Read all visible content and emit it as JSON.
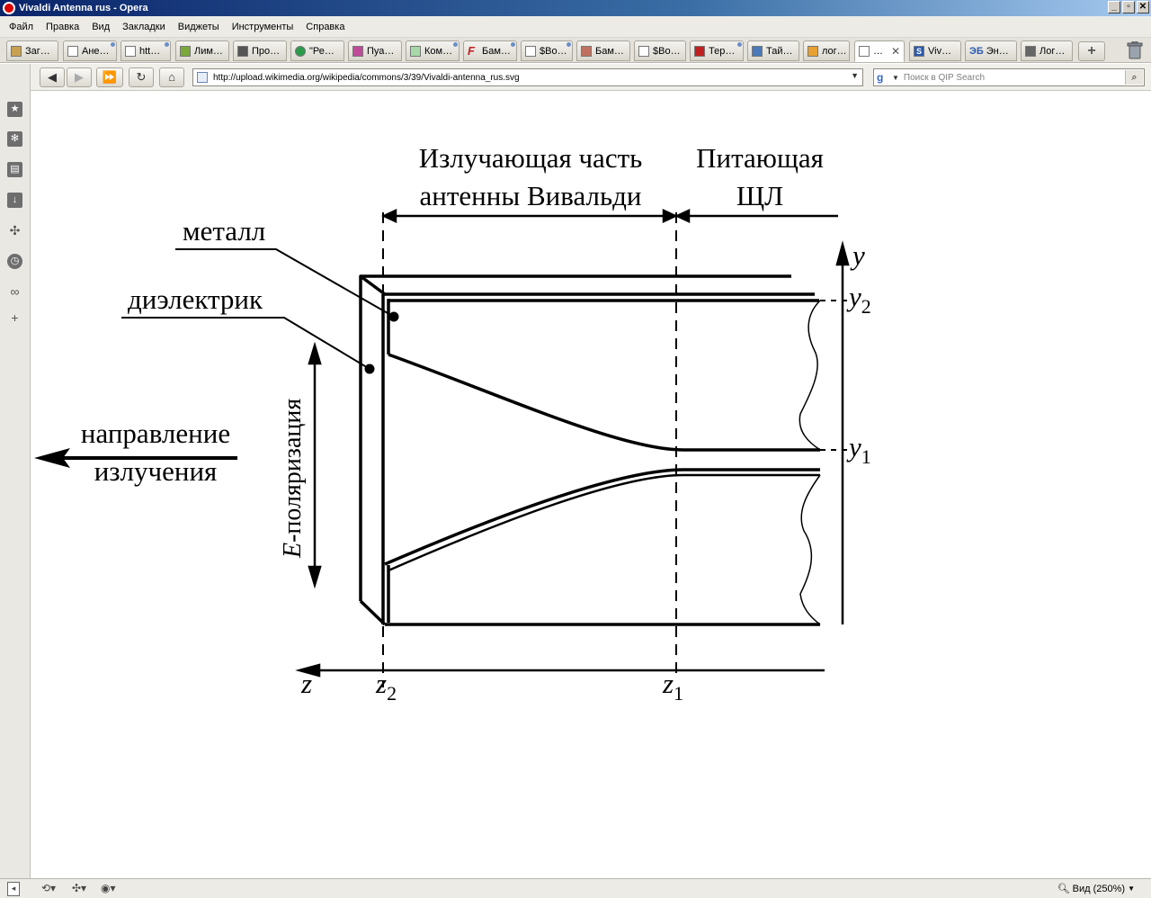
{
  "window": {
    "title": "Vivaldi Antenna rus - Opera",
    "buttons": {
      "minimize": "_",
      "maximize": "▫",
      "close": "✕"
    }
  },
  "menu": [
    "Файл",
    "Правка",
    "Вид",
    "Закладки",
    "Виджеты",
    "Инструменты",
    "Справка"
  ],
  "tabs": [
    {
      "label": "Заг…",
      "icon": "download-icon"
    },
    {
      "label": "Ане…",
      "icon": "page-icon"
    },
    {
      "label": "htt…",
      "icon": "page-icon"
    },
    {
      "label": "Лим…",
      "icon": "plant-icon"
    },
    {
      "label": "Про…",
      "icon": "satellite-icon"
    },
    {
      "label": "\"Ре…",
      "icon": "circle-icon"
    },
    {
      "label": "Пуа…",
      "icon": "flower-icon"
    },
    {
      "label": "Ком…",
      "icon": "leaf-icon"
    },
    {
      "label": "Бам…",
      "icon": "f-icon"
    },
    {
      "label": "$Bo…",
      "icon": "page-icon"
    },
    {
      "label": "Бам…",
      "icon": "photo-icon"
    },
    {
      "label": "$Bo…",
      "icon": "page-icon"
    },
    {
      "label": "Тер…",
      "icon": "pet-icon"
    },
    {
      "label": "Тай…",
      "icon": "grid-icon"
    },
    {
      "label": "лог…",
      "icon": "google-icon"
    },
    {
      "label": "…",
      "icon": "page-icon",
      "active": true,
      "close": "✕"
    },
    {
      "label": "Viv…",
      "icon": "s-icon"
    },
    {
      "label": "Эн…",
      "icon": "eb-icon",
      "prefix": "ЭБ"
    },
    {
      "label": "Лог…",
      "icon": "chip-icon"
    }
  ],
  "new_tab_label": "+",
  "nav": {
    "back": "◀",
    "forward": "▶",
    "fast_forward": "⏩",
    "reload": "↻",
    "home": "⌂",
    "url": "http://upload.wikimedia.org/wikipedia/commons/3/39/Vivaldi-antenna_rus.svg",
    "url_dropdown": "▼",
    "search_engine": "g",
    "search_dropdown": "▼",
    "search_placeholder": "Поиск в QIP Search",
    "search_button": "⌕"
  },
  "sidebar": [
    "bookmarks-icon",
    "widgets-icon",
    "notes-icon",
    "downloads-icon",
    "transfers-icon",
    "history-icon",
    "links-icon",
    "add-panel-icon"
  ],
  "diagram": {
    "heading_radiating_line1": "Излучающая часть",
    "heading_radiating_line2": "антенны Вивальди",
    "heading_feed_line1": "Питающая",
    "heading_feed_line2": "ЩЛ",
    "label_metal": "металл",
    "label_dielectric": "диэлектрик",
    "label_direction_line1": "направление",
    "label_direction_line2": "излучения",
    "label_polarization_italic": "E",
    "label_polarization_rest": "-поляризация",
    "axis_y": "y",
    "axis_y2_base": "y",
    "axis_y2_sub": "2",
    "axis_y1_base": "y",
    "axis_y1_sub": "1",
    "axis_z": "z",
    "axis_z2_base": "z",
    "axis_z2_sub": "2",
    "axis_z1_base": "z",
    "axis_z1_sub": "1"
  },
  "status": {
    "zoom_label": "Вид (250%)",
    "zoom_dropdown": "▼"
  }
}
